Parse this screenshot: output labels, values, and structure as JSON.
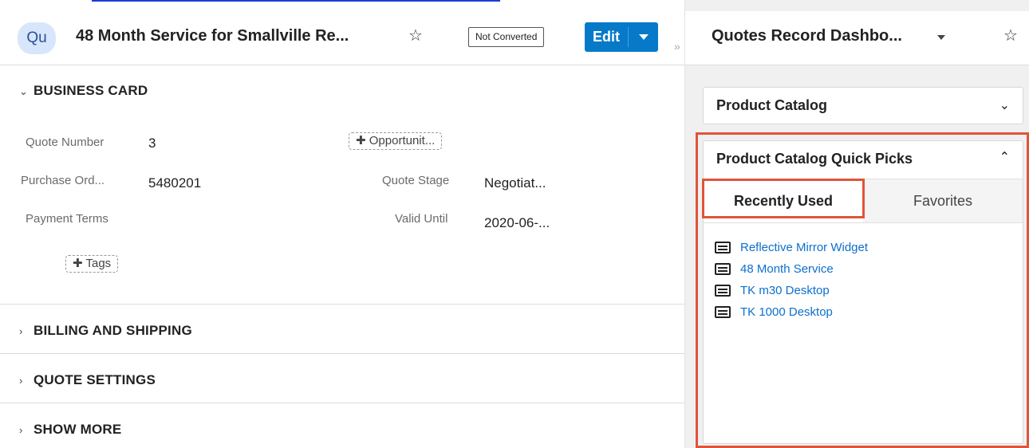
{
  "record": {
    "avatar": "Qu",
    "title": "48 Month Service for Smallville Re...",
    "status_badge": "Not Converted",
    "edit_label": "Edit"
  },
  "sections": {
    "business_card": {
      "title": "BUSINESS CARD",
      "quote_number_label": "Quote Number",
      "quote_number_value": "3",
      "opportunity_pill": "Opportunit...",
      "purchase_order_label": "Purchase Ord...",
      "purchase_order_value": "5480201",
      "quote_stage_label": "Quote Stage",
      "quote_stage_value": "Negotiat...",
      "payment_terms_label": "Payment Terms",
      "valid_until_label": "Valid Until",
      "valid_until_value": "2020-06-...",
      "tags_pill": "Tags"
    },
    "billing_shipping": "BILLING AND SHIPPING",
    "quote_settings": "QUOTE SETTINGS",
    "show_more": "SHOW MORE"
  },
  "dashboard": {
    "title": "Quotes Record Dashbo...",
    "product_catalog": "Product Catalog",
    "quick_picks": {
      "title": "Product Catalog Quick Picks",
      "tabs": [
        "Recently Used",
        "Favorites"
      ],
      "items": [
        "Reflective Mirror Widget",
        "48 Month Service",
        "TK m30 Desktop",
        "TK 1000 Desktop"
      ]
    }
  },
  "colors": {
    "accent": "#0679c8",
    "highlight": "#e0543a",
    "link": "#0d6fcc"
  }
}
